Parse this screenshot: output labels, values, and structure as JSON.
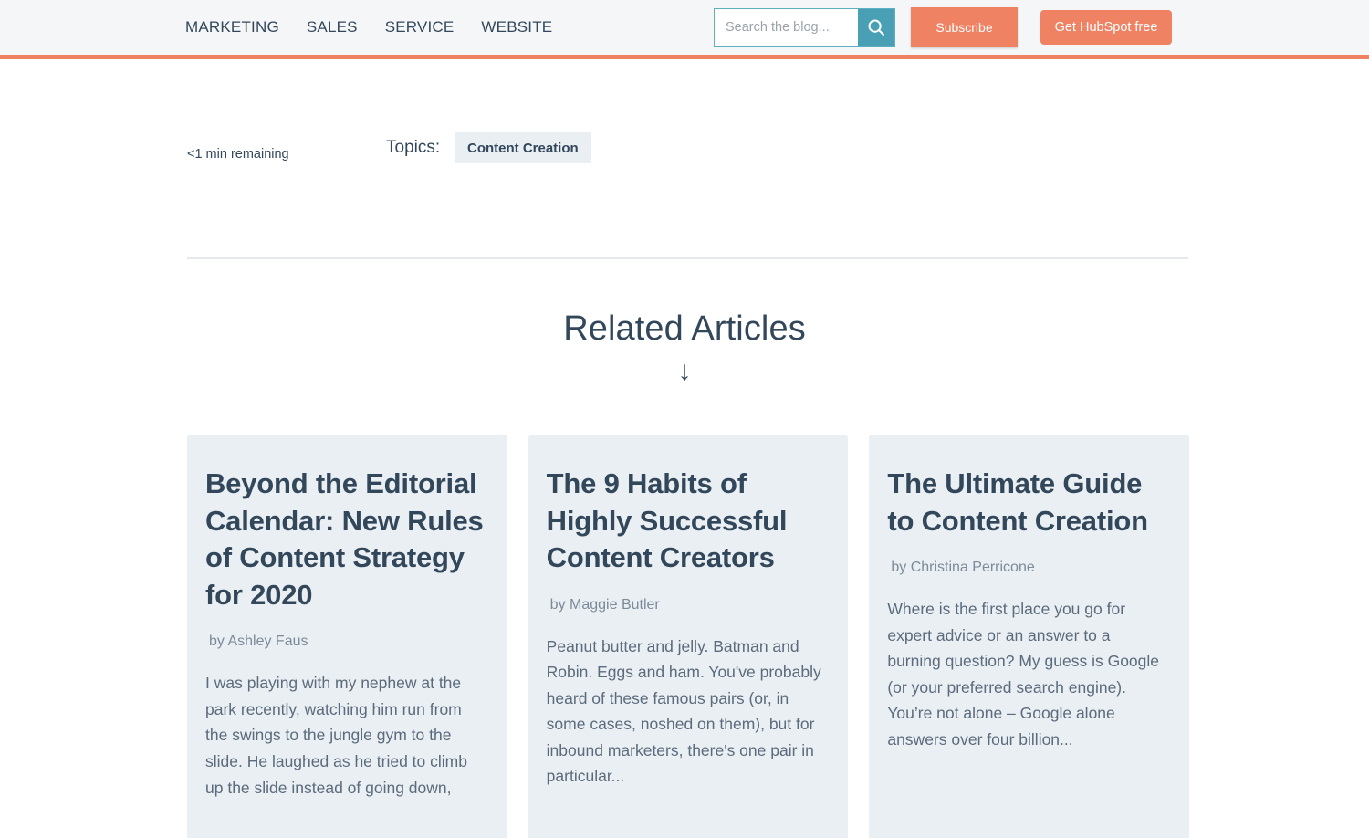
{
  "header": {
    "nav": [
      {
        "label": "MARKETING"
      },
      {
        "label": "SALES"
      },
      {
        "label": "SERVICE"
      },
      {
        "label": "WEBSITE"
      }
    ],
    "search": {
      "placeholder": "Search the blog...",
      "value": "",
      "icon": "search-icon"
    },
    "subscribe_label": "Subscribe",
    "cta_label": "Get HubSpot free",
    "accent_color": "#ef8262",
    "search_accent_color": "#49a0b5",
    "background_color": "#f5f6f7"
  },
  "post_meta": {
    "read_time": "<1 min remaining",
    "topics_label": "Topics:",
    "topics": [
      {
        "label": "Content Creation"
      }
    ]
  },
  "related": {
    "heading": "Related Articles",
    "arrow_icon": "arrow-down-icon",
    "arrow_glyph": "↓",
    "articles": [
      {
        "title": "Beyond the Editorial Calendar: New Rules of Content Strategy for 2020",
        "author": "by Ashley Faus",
        "excerpt": "I was playing with my nephew at the park recently, watching him run from the swings to the jungle gym to the slide. He laughed as he tried to climb up the slide instead of going down,"
      },
      {
        "title": "The 9 Habits of Highly Successful Content Creators",
        "author": "by Maggie Butler",
        "excerpt": "Peanut butter and jelly. Batman and Robin. Eggs and ham. You've probably heard of these famous pairs (or, in some cases, noshed on them), but for inbound marketers, there's one pair in particular..."
      },
      {
        "title": "The Ultimate Guide to Content Creation",
        "author": "by Christina Perricone",
        "excerpt": "Where is the first place you go for expert advice or an answer to a burning question? My guess is Google (or your preferred search engine). You’re not alone – Google alone answers over four billion..."
      }
    ],
    "card_background_color": "#eaeff4",
    "text_color": "#33475b"
  }
}
